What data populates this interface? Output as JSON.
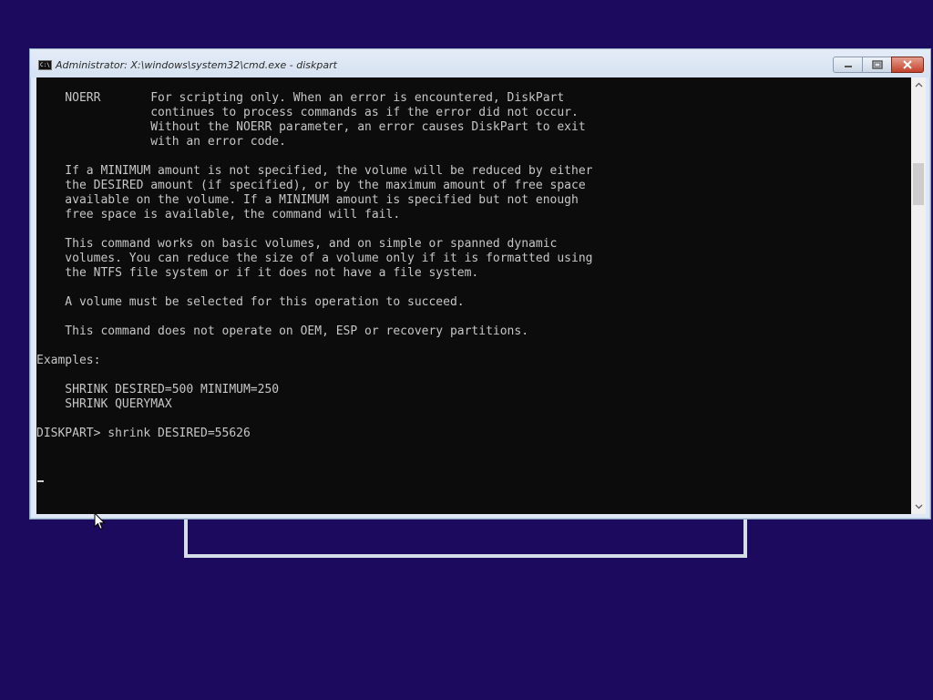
{
  "window": {
    "title": "Administrator: X:\\windows\\system32\\cmd.exe - diskpart",
    "icon_label": "C:\\",
    "minimize_icon": "minimize-icon",
    "restore_icon": "restore-icon",
    "close_icon": "close-icon"
  },
  "console": {
    "text": "    NOERR       For scripting only. When an error is encountered, DiskPart\n                continues to process commands as if the error did not occur.\n                Without the NOERR parameter, an error causes DiskPart to exit\n                with an error code.\n\n    If a MINIMUM amount is not specified, the volume will be reduced by either\n    the DESIRED amount (if specified), or by the maximum amount of free space\n    available on the volume. If a MINIMUM amount is specified but not enough\n    free space is available, the command will fail.\n\n    This command works on basic volumes, and on simple or spanned dynamic\n    volumes. You can reduce the size of a volume only if it is formatted using\n    the NTFS file system or if it does not have a file system.\n\n    A volume must be selected for this operation to succeed.\n\n    This command does not operate on OEM, ESP or recovery partitions.\n\nExamples:\n\n    SHRINK DESIRED=500 MINIMUM=250\n    SHRINK QUERYMAX\n\nDISKPART> shrink DESIRED=55626",
    "background": "#0c0c0c",
    "foreground": "#c6c6c6"
  },
  "scrollbar": {
    "up_icon": "chevron-up-icon",
    "down_icon": "chevron-down-icon"
  },
  "desktop": {
    "background": "#1c0a5e"
  }
}
